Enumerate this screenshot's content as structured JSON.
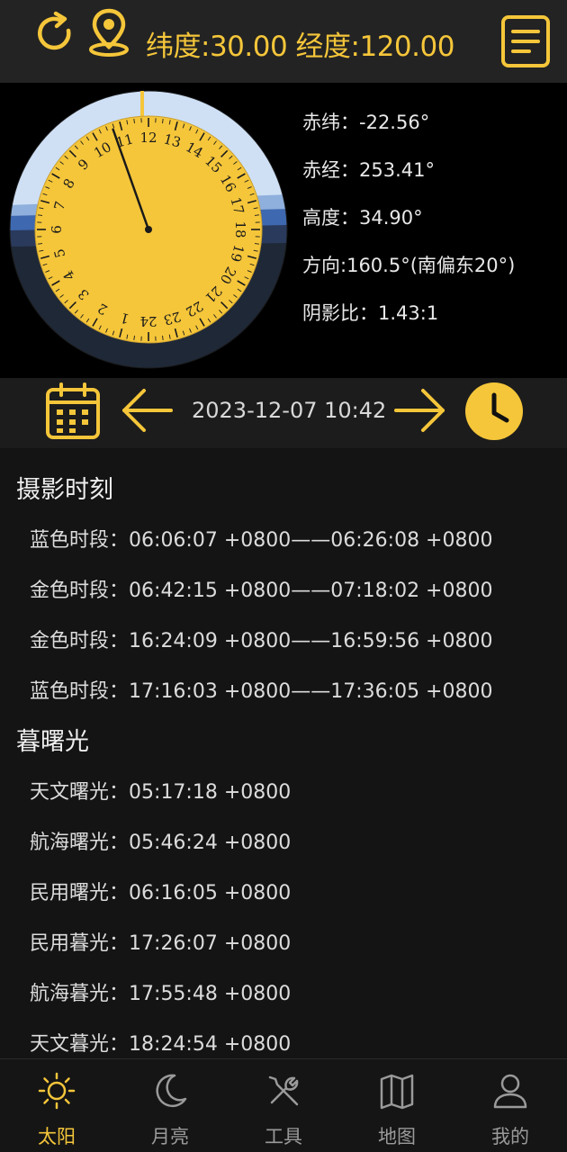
{
  "colors": {
    "accent": "#f5c63a",
    "background": "#101010",
    "topbar": "#232323"
  },
  "header": {
    "coords_text": "纬度:30.00 经度:120.00"
  },
  "sun_info": [
    {
      "label": "赤纬",
      "value": "-22.56°"
    },
    {
      "label": "赤经",
      "value": "253.41°"
    },
    {
      "label": "高度",
      "value": "34.90°"
    },
    {
      "label": "方向",
      "value": "160.5°(南偏东20°)"
    },
    {
      "label": "阴影比",
      "value": "1.43:1"
    }
  ],
  "dial": {
    "hour_numbers": [
      "1",
      "2",
      "3",
      "4",
      "5",
      "6",
      "7",
      "8",
      "9",
      "10",
      "11",
      "12",
      "13",
      "14",
      "15",
      "16",
      "17",
      "18",
      "19",
      "20",
      "21",
      "22",
      "23",
      "24"
    ],
    "current_hour": 10.7
  },
  "datebar": {
    "datetime": "2023-12-07 10:42"
  },
  "photo_section": {
    "title": "摄影时刻",
    "items": [
      {
        "label": "蓝色时段",
        "value": "06:06:07 +0800——06:26:08 +0800"
      },
      {
        "label": "金色时段",
        "value": "06:42:15 +0800——07:18:02 +0800"
      },
      {
        "label": "金色时段",
        "value": "16:24:09 +0800——16:59:56 +0800"
      },
      {
        "label": "蓝色时段",
        "value": "17:16:03 +0800——17:36:05 +0800"
      }
    ]
  },
  "twilight_section": {
    "title": "暮曙光",
    "items": [
      {
        "label": "天文曙光",
        "value": "05:17:18 +0800"
      },
      {
        "label": "航海曙光",
        "value": "05:46:24 +0800"
      },
      {
        "label": "民用曙光",
        "value": "06:16:05 +0800"
      },
      {
        "label": "民用暮光",
        "value": "17:26:07 +0800"
      },
      {
        "label": "航海暮光",
        "value": "17:55:48 +0800"
      },
      {
        "label": "天文暮光",
        "value": "18:24:54 +0800"
      }
    ]
  },
  "nav": [
    {
      "label": "太阳",
      "icon": "sun-icon",
      "active": true
    },
    {
      "label": "月亮",
      "icon": "moon-icon",
      "active": false
    },
    {
      "label": "工具",
      "icon": "tools-icon",
      "active": false
    },
    {
      "label": "地图",
      "icon": "map-icon",
      "active": false
    },
    {
      "label": "我的",
      "icon": "user-icon",
      "active": false
    }
  ]
}
